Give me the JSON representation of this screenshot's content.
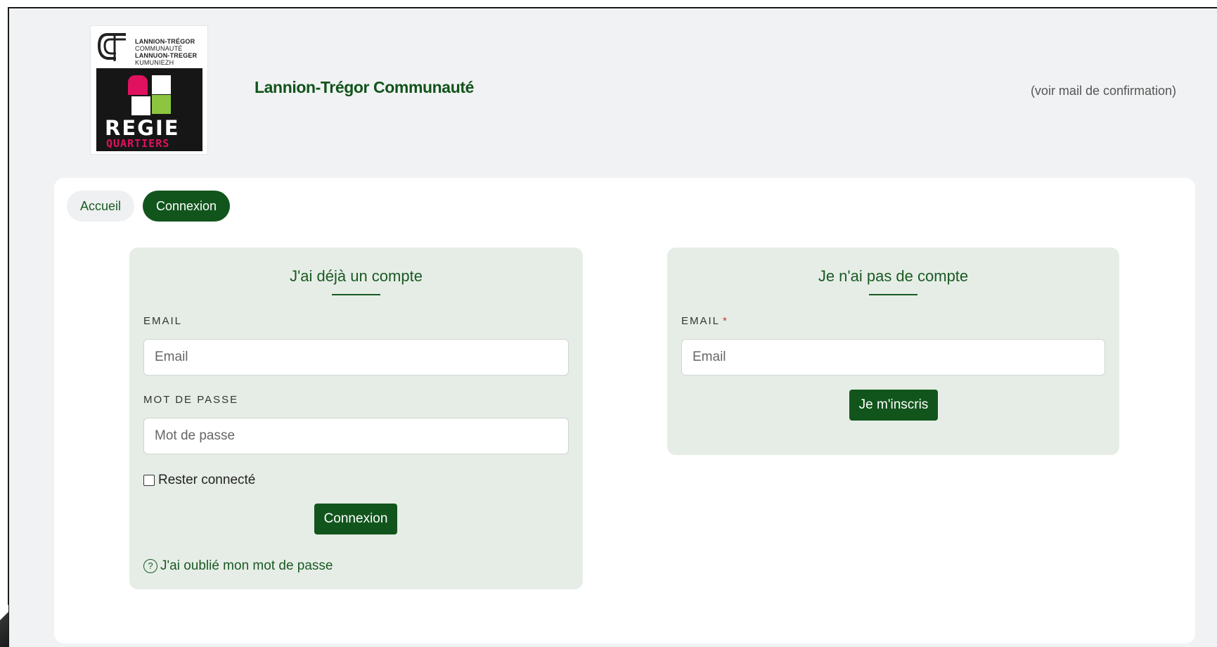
{
  "header": {
    "logo_lines": [
      "LANNION-TRÉGOR",
      "COMMUNAUTÉ",
      "LANNUON-TREGER",
      "KUMUNIEZH"
    ],
    "logo_regie": "REGIE",
    "logo_quartiers": "QUARTIERS",
    "site_title": "Lannion-Trégor Communauté",
    "note": "(voir mail de confirmation)"
  },
  "nav": {
    "home_label": "Accueil",
    "login_label": "Connexion"
  },
  "login_panel": {
    "title": "J'ai déjà un compte",
    "email_label": "EMAIL",
    "email_placeholder": "Email",
    "password_label": "MOT DE PASSE",
    "password_placeholder": "Mot de passe",
    "remember_label": "Rester connecté",
    "submit_label": "Connexion",
    "forgot_label": "J'ai oublié mon mot de passe"
  },
  "signup_panel": {
    "title": "Je n'ai pas de compte",
    "email_label": "EMAIL",
    "required_marker": "*",
    "email_placeholder": "Email",
    "submit_label": "Je m'inscris"
  },
  "colors": {
    "accent": "#11551c",
    "panel_bg": "#e6ede7",
    "page_bg": "#f0f2f3"
  }
}
